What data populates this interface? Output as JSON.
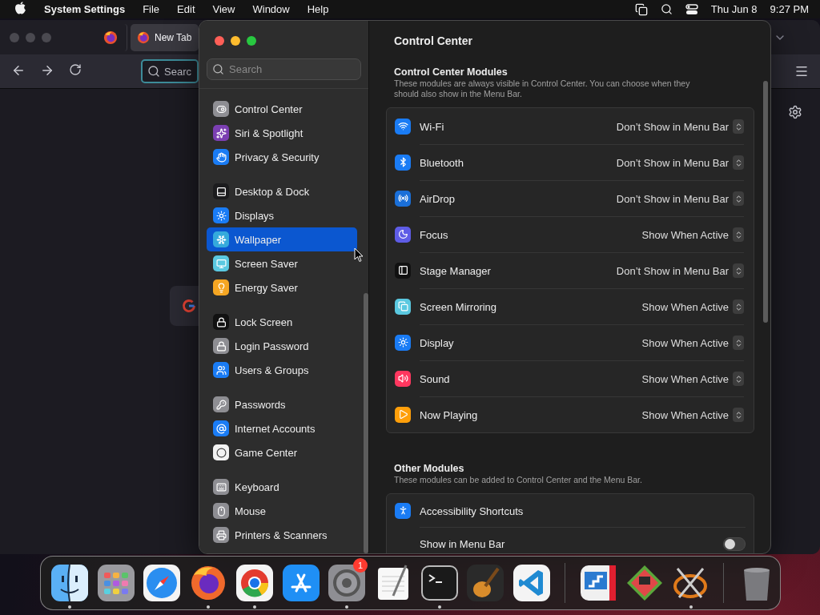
{
  "menu_bar": {
    "app_name": "System Settings",
    "menus": [
      "File",
      "Edit",
      "View",
      "Window",
      "Help"
    ],
    "date": "Thu Jun 8",
    "time": "9:27 PM"
  },
  "browser": {
    "tabs": [
      {
        "kind": "pinned",
        "selected": false
      },
      {
        "kind": "normal",
        "label": "New Tab",
        "selected": true
      }
    ],
    "search": {
      "placeholder": "Searc"
    }
  },
  "settings": {
    "search": {
      "placeholder": "Search"
    },
    "sidebar": {
      "groups": [
        [
          {
            "label": "Control Center",
            "selected": false,
            "color": "#8e8e93"
          },
          {
            "label": "Siri & Spotlight",
            "selected": false,
            "color": "#7b3fb2"
          },
          {
            "label": "Privacy & Security",
            "selected": false,
            "color": "#1a7cf5"
          }
        ],
        [
          {
            "label": "Desktop & Dock",
            "selected": false,
            "color": "#1c1c1e"
          },
          {
            "label": "Displays",
            "selected": false,
            "color": "#1a7cf5"
          },
          {
            "label": "Wallpaper",
            "selected": true,
            "color": "#35aadc"
          },
          {
            "label": "Screen Saver",
            "selected": false,
            "color": "#5ac8e0"
          },
          {
            "label": "Energy Saver",
            "selected": false,
            "color": "#f5a623"
          }
        ],
        [
          {
            "label": "Lock Screen",
            "selected": false,
            "color": "#111111"
          },
          {
            "label": "Login Password",
            "selected": false,
            "color": "#8e8e93"
          },
          {
            "label": "Users & Groups",
            "selected": false,
            "color": "#1a7cf5"
          }
        ],
        [
          {
            "label": "Passwords",
            "selected": false,
            "color": "#8e8e93"
          },
          {
            "label": "Internet Accounts",
            "selected": false,
            "color": "#1a7cf5"
          },
          {
            "label": "Game Center",
            "selected": false,
            "color": "#f2f2f2"
          }
        ],
        [
          {
            "label": "Keyboard",
            "selected": false,
            "color": "#8e8e93"
          },
          {
            "label": "Mouse",
            "selected": false,
            "color": "#8e8e93"
          },
          {
            "label": "Printers & Scanners",
            "selected": false,
            "color": "#8e8e93"
          }
        ]
      ]
    },
    "title": "Control Center",
    "sections": [
      {
        "heading": "Control Center Modules",
        "description": "These modules are always visible in Control Center. You can choose when they should also show in the Menu Bar.",
        "items": [
          {
            "label": "Wi-Fi",
            "value": "Don’t Show in Menu Bar",
            "color": "#1a7cf5"
          },
          {
            "label": "Bluetooth",
            "value": "Don’t Show in Menu Bar",
            "color": "#1a7cf5"
          },
          {
            "label": "AirDrop",
            "value": "Don’t Show in Menu Bar",
            "color": "#1a6fd8"
          },
          {
            "label": "Focus",
            "value": "Show When Active",
            "color": "#5e5ce6"
          },
          {
            "label": "Stage Manager",
            "value": "Don’t Show in Menu Bar",
            "color": "#111111"
          },
          {
            "label": "Screen Mirroring",
            "value": "Show When Active",
            "color": "#5ac8e0"
          },
          {
            "label": "Display",
            "value": "Show When Active",
            "color": "#1a7cf5"
          },
          {
            "label": "Sound",
            "value": "Show When Active",
            "color": "#ff375f"
          },
          {
            "label": "Now Playing",
            "value": "Show When Active",
            "color": "#ff9f0a"
          }
        ]
      },
      {
        "heading": "Other Modules",
        "description": "These modules can be added to Control Center and the Menu Bar.",
        "items": [
          {
            "label": "Accessibility Shortcuts",
            "color": "#1a7cf5",
            "options": [
              {
                "label": "Show in Menu Bar",
                "on": false
              }
            ]
          }
        ]
      }
    ]
  },
  "dock": {
    "groups": [
      [
        {
          "running": true
        },
        {
          "running": false
        },
        {
          "running": false
        },
        {
          "running": true
        },
        {
          "running": true
        },
        {
          "running": false
        },
        {
          "running": true,
          "badge": "1"
        },
        {
          "running": false
        },
        {
          "running": true
        },
        {
          "running": false
        },
        {
          "running": false
        }
      ],
      [
        {
          "running": false
        },
        {
          "running": false
        },
        {
          "running": true
        }
      ],
      [
        {
          "running": false
        }
      ]
    ]
  }
}
